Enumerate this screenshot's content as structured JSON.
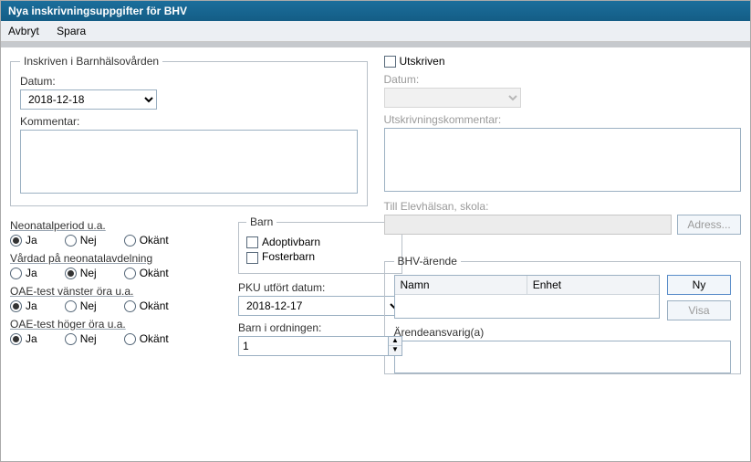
{
  "window": {
    "title": "Nya inskrivningsuppgifter för BHV"
  },
  "menu": {
    "cancel": "Avbryt",
    "save": "Spara"
  },
  "inskriven": {
    "legend": "Inskriven i Barnhälsovården",
    "datum_label": "Datum:",
    "datum_value": "2018-12-18",
    "kommentar_label": "Kommentar:",
    "kommentar_value": ""
  },
  "groups": {
    "neonatal": {
      "label": "Neonatalperiod u.a.",
      "selected": "Ja"
    },
    "vardad": {
      "label": "Vårdad på neonatalavdelning",
      "selected": "Nej"
    },
    "oae_v": {
      "label": "OAE-test vänster öra u.a.",
      "selected": "Ja"
    },
    "oae_h": {
      "label": "OAE-test höger öra u.a.",
      "selected": "Ja"
    },
    "options": {
      "ja": "Ja",
      "nej": "Nej",
      "okant": "Okänt"
    }
  },
  "barn": {
    "legend": "Barn",
    "adoptiv": "Adoptivbarn",
    "foster": "Fosterbarn",
    "pku_label": "PKU utfört datum:",
    "pku_value": "2018-12-17",
    "ordning_label": "Barn i ordningen:",
    "ordning_value": "1"
  },
  "utskriven": {
    "checkbox_label": "Utskriven",
    "datum_label": "Datum:",
    "datum_value": "",
    "kommentar_label": "Utskrivningskommentar:",
    "kommentar_value": "",
    "skola_label": "Till Elevhälsan, skola:",
    "skola_value": "",
    "adress_btn": "Adress..."
  },
  "arende": {
    "legend": "BHV-ärende",
    "col_namn": "Namn",
    "col_enhet": "Enhet",
    "ny": "Ny",
    "visa": "Visa",
    "ansvarig_label": "Ärendeansvarig(a)"
  }
}
